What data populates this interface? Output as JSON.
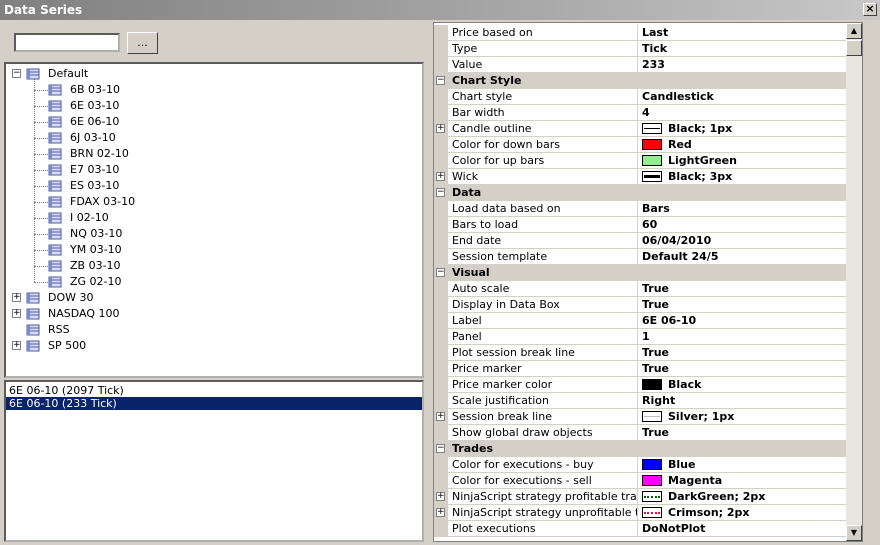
{
  "window": {
    "title": "Data Series",
    "close_glyph": "×"
  },
  "search": {
    "value": "",
    "browse_label": "..."
  },
  "tree": {
    "default_group": "Default",
    "default_items": [
      "6B 03-10",
      "6E 03-10",
      "6E 06-10",
      "6J 03-10",
      "BRN 02-10",
      "E7 03-10",
      "ES 03-10",
      "FDAX 03-10",
      "I 02-10",
      "NQ 03-10",
      "YM 03-10",
      "ZB 03-10",
      "ZG 02-10"
    ],
    "other_groups": [
      {
        "label": "DOW 30",
        "expandable": true
      },
      {
        "label": "NASDAQ 100",
        "expandable": true
      },
      {
        "label": "RSS",
        "expandable": false
      },
      {
        "label": "SP 500",
        "expandable": true
      }
    ],
    "expand_glyph": "+",
    "collapse_glyph": "−"
  },
  "series": [
    {
      "label": "6E 06-10 (2097 Tick)",
      "selected": false
    },
    {
      "label": "6E 06-10 (233 Tick)",
      "selected": true
    }
  ],
  "properties": [
    {
      "kind": "prop",
      "name": "Price based on",
      "value": "Last"
    },
    {
      "kind": "prop",
      "name": "Type",
      "value": "Tick"
    },
    {
      "kind": "prop",
      "name": "Value",
      "value": "233"
    },
    {
      "kind": "cat",
      "name": "Chart Style"
    },
    {
      "kind": "prop",
      "name": "Chart style",
      "value": "Candlestick"
    },
    {
      "kind": "prop",
      "name": "Bar width",
      "value": "4"
    },
    {
      "kind": "prop",
      "name": "Candle outline",
      "value": "Black; 1px",
      "expandable": true,
      "swatch": "line"
    },
    {
      "kind": "prop",
      "name": "Color for down bars",
      "value": "Red",
      "swatch_color": "#ff0000"
    },
    {
      "kind": "prop",
      "name": "Color for up bars",
      "value": "LightGreen",
      "swatch_color": "#90ee90"
    },
    {
      "kind": "prop",
      "name": "Wick",
      "value": "Black; 3px",
      "expandable": true,
      "swatch": "line3"
    },
    {
      "kind": "cat",
      "name": "Data"
    },
    {
      "kind": "prop",
      "name": "Load data based on",
      "value": "Bars"
    },
    {
      "kind": "prop",
      "name": "Bars to load",
      "value": "60"
    },
    {
      "kind": "prop",
      "name": "End date",
      "value": "06/04/2010"
    },
    {
      "kind": "prop",
      "name": "Session template",
      "value": "Default 24/5"
    },
    {
      "kind": "cat",
      "name": "Visual"
    },
    {
      "kind": "prop",
      "name": "Auto scale",
      "value": "True"
    },
    {
      "kind": "prop",
      "name": "Display in Data Box",
      "value": "True"
    },
    {
      "kind": "prop",
      "name": "Label",
      "value": "6E 06-10"
    },
    {
      "kind": "prop",
      "name": "Panel",
      "value": "1"
    },
    {
      "kind": "prop",
      "name": "Plot session break line",
      "value": "True"
    },
    {
      "kind": "prop",
      "name": "Price marker",
      "value": "True"
    },
    {
      "kind": "prop",
      "name": "Price marker color",
      "value": "Black",
      "swatch_color": "#000000"
    },
    {
      "kind": "prop",
      "name": "Scale justification",
      "value": "Right"
    },
    {
      "kind": "prop",
      "name": "Session break line",
      "value": "Silver; 1px",
      "expandable": true,
      "swatch": "silverline"
    },
    {
      "kind": "prop",
      "name": "Show global draw objects",
      "value": "True"
    },
    {
      "kind": "cat",
      "name": "Trades"
    },
    {
      "kind": "prop",
      "name": "Color for executions - buy",
      "value": "Blue",
      "swatch_color": "#0000ff"
    },
    {
      "kind": "prop",
      "name": "Color for executions - sell",
      "value": "Magenta",
      "swatch_color": "#ff00ff"
    },
    {
      "kind": "prop",
      "name": "NinjaScript strategy profitable trade line",
      "value": "DarkGreen; 2px",
      "expandable": true,
      "swatch": "dotgreen"
    },
    {
      "kind": "prop",
      "name": "NinjaScript strategy unprofitable trade line",
      "value": "Crimson; 2px",
      "expandable": true,
      "swatch": "dotcrimson"
    },
    {
      "kind": "prop",
      "name": "Plot executions",
      "value": "DoNotPlot"
    }
  ],
  "scrollbar": {
    "up_glyph": "▲",
    "down_glyph": "▼"
  },
  "colors": {
    "selection": "#0a246a",
    "face": "#d4d0c8"
  }
}
